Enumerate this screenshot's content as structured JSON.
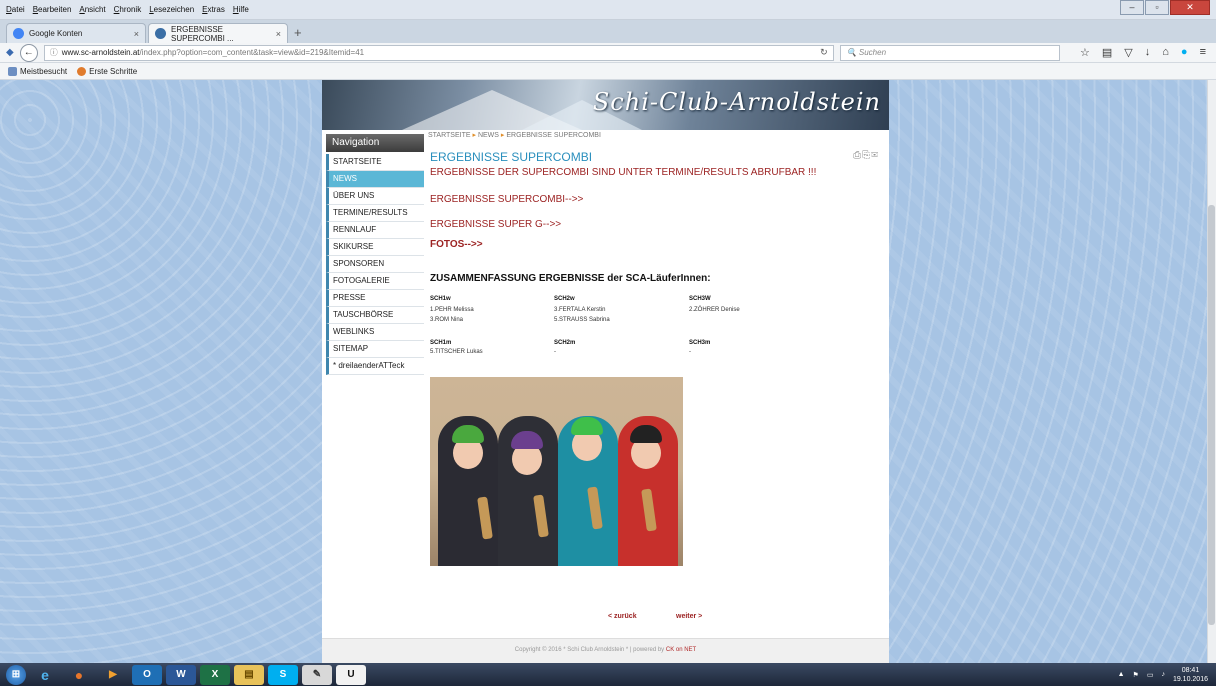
{
  "browser": {
    "menu": [
      {
        "u": "D",
        "rest": "atei"
      },
      {
        "u": "B",
        "rest": "earbeiten"
      },
      {
        "u": "A",
        "rest": "nsicht"
      },
      {
        "u": "C",
        "rest": "hronik"
      },
      {
        "u": "L",
        "rest": "esezeichen"
      },
      {
        "u": "E",
        "rest": "xtras"
      },
      {
        "u": "H",
        "rest": "ilfe"
      }
    ],
    "tabs": [
      {
        "label": "Google Konten",
        "close": "×"
      },
      {
        "label": "ERGEBNISSE SUPERCOMBI ...",
        "close": "×"
      }
    ],
    "newtab": "+",
    "url_domain": "www.sc-arnoldstein.at",
    "url_path": "/index.php?option=com_content&task=view&id=219&Itemid=41",
    "search_placeholder": "Suchen",
    "bookmarks": [
      "Meistbesucht",
      "Erste Schritte"
    ],
    "colors": {
      "accent": "#5bb7d6",
      "link_red": "#9c2323",
      "title_blue": "#2a8fbd"
    }
  },
  "site": {
    "banner_title": "Schi-Club-Arnoldstein",
    "nav_heading": "Navigation",
    "nav_items": [
      "STARTSEITE",
      "NEWS",
      "ÜBER UNS",
      "TERMINE/RESULTS",
      "RENNLAUF",
      "SKIKURSE",
      "SPONSOREN",
      "FOTOGALERIE",
      "PRESSE",
      "TAUSCHBÖRSE",
      "WEBLINKS",
      "SITEMAP",
      "* dreilaenderATTeck"
    ],
    "active_nav": "NEWS",
    "breadcrumb": [
      "STARTSEITE",
      "NEWS",
      "ERGEBNISSE SUPERCOMBI"
    ],
    "article_title": "ERGEBNISSE SUPERCOMBI",
    "line1": "ERGEBNISSE DER SUPERCOMBI SIND UNTER TERMINE/RESULTS ABRUFBAR !!!",
    "line2": "ERGEBNISSE SUPERCOMBI-->>",
    "line3": "ERGEBNISSE SUPER G-->>",
    "line4": "FOTOS-->>",
    "summary_title": "ZUSAMMENFASSUNG ERGEBNISSE der SCA-LäuferInnen:",
    "results": {
      "sch1w_h": "SCH1w",
      "sch2w_h": "SCH2w",
      "sch3w_h": "SCH3W",
      "sch1w": [
        "1.PEHR Melissa",
        "3.ROM Nina"
      ],
      "sch2w": [
        "3.FERTALA Kerstin",
        "5.STRAUSS Sabrina"
      ],
      "sch3w": [
        "2.ZÖHRER Denise"
      ],
      "sch1m_h": "SCH1m",
      "sch2m_h": "SCH2m",
      "sch3m_h": "SCH3m",
      "sch1m": [
        "5.TITSCHER Lukas"
      ],
      "sch2m": [
        "-"
      ],
      "sch3m": [
        "-"
      ]
    },
    "prev": "< zurück",
    "next": "weiter >",
    "footer_text": "Copyright © 2016 * Schi Club Arnoldstein * | powered by ",
    "footer_link": "CK on NET"
  },
  "taskbar": {
    "time": "08:41",
    "date": "19.10.2016"
  }
}
